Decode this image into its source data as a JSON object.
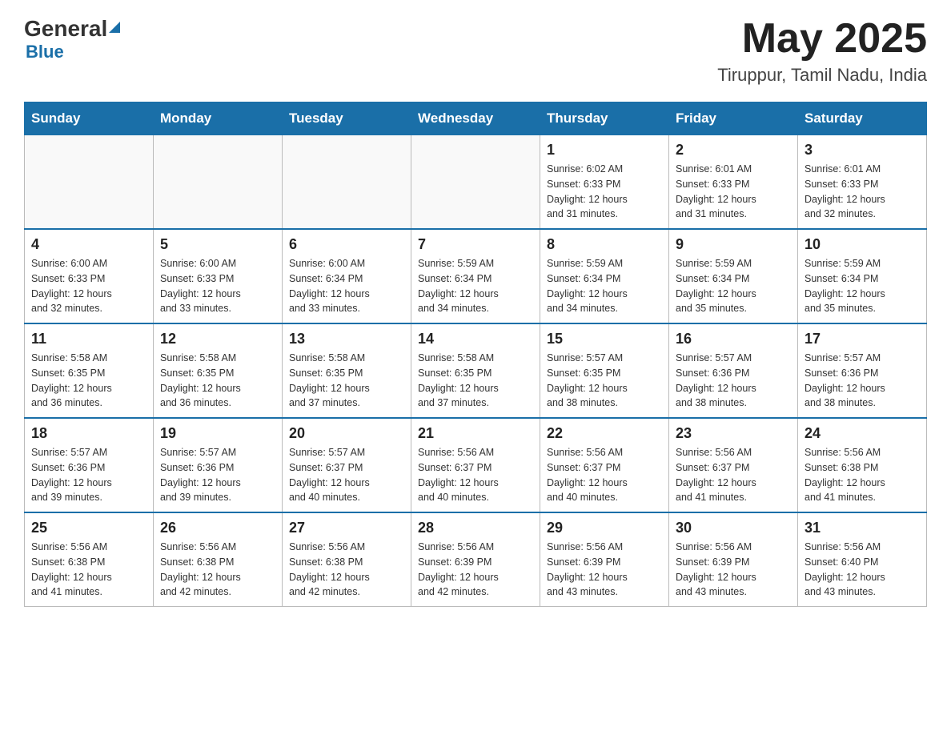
{
  "header": {
    "logo_general": "General",
    "logo_blue": "Blue",
    "month": "May 2025",
    "location": "Tiruppur, Tamil Nadu, India"
  },
  "days_of_week": [
    "Sunday",
    "Monday",
    "Tuesday",
    "Wednesday",
    "Thursday",
    "Friday",
    "Saturday"
  ],
  "weeks": [
    [
      {
        "day": "",
        "info": ""
      },
      {
        "day": "",
        "info": ""
      },
      {
        "day": "",
        "info": ""
      },
      {
        "day": "",
        "info": ""
      },
      {
        "day": "1",
        "info": "Sunrise: 6:02 AM\nSunset: 6:33 PM\nDaylight: 12 hours\nand 31 minutes."
      },
      {
        "day": "2",
        "info": "Sunrise: 6:01 AM\nSunset: 6:33 PM\nDaylight: 12 hours\nand 31 minutes."
      },
      {
        "day": "3",
        "info": "Sunrise: 6:01 AM\nSunset: 6:33 PM\nDaylight: 12 hours\nand 32 minutes."
      }
    ],
    [
      {
        "day": "4",
        "info": "Sunrise: 6:00 AM\nSunset: 6:33 PM\nDaylight: 12 hours\nand 32 minutes."
      },
      {
        "day": "5",
        "info": "Sunrise: 6:00 AM\nSunset: 6:33 PM\nDaylight: 12 hours\nand 33 minutes."
      },
      {
        "day": "6",
        "info": "Sunrise: 6:00 AM\nSunset: 6:34 PM\nDaylight: 12 hours\nand 33 minutes."
      },
      {
        "day": "7",
        "info": "Sunrise: 5:59 AM\nSunset: 6:34 PM\nDaylight: 12 hours\nand 34 minutes."
      },
      {
        "day": "8",
        "info": "Sunrise: 5:59 AM\nSunset: 6:34 PM\nDaylight: 12 hours\nand 34 minutes."
      },
      {
        "day": "9",
        "info": "Sunrise: 5:59 AM\nSunset: 6:34 PM\nDaylight: 12 hours\nand 35 minutes."
      },
      {
        "day": "10",
        "info": "Sunrise: 5:59 AM\nSunset: 6:34 PM\nDaylight: 12 hours\nand 35 minutes."
      }
    ],
    [
      {
        "day": "11",
        "info": "Sunrise: 5:58 AM\nSunset: 6:35 PM\nDaylight: 12 hours\nand 36 minutes."
      },
      {
        "day": "12",
        "info": "Sunrise: 5:58 AM\nSunset: 6:35 PM\nDaylight: 12 hours\nand 36 minutes."
      },
      {
        "day": "13",
        "info": "Sunrise: 5:58 AM\nSunset: 6:35 PM\nDaylight: 12 hours\nand 37 minutes."
      },
      {
        "day": "14",
        "info": "Sunrise: 5:58 AM\nSunset: 6:35 PM\nDaylight: 12 hours\nand 37 minutes."
      },
      {
        "day": "15",
        "info": "Sunrise: 5:57 AM\nSunset: 6:35 PM\nDaylight: 12 hours\nand 38 minutes."
      },
      {
        "day": "16",
        "info": "Sunrise: 5:57 AM\nSunset: 6:36 PM\nDaylight: 12 hours\nand 38 minutes."
      },
      {
        "day": "17",
        "info": "Sunrise: 5:57 AM\nSunset: 6:36 PM\nDaylight: 12 hours\nand 38 minutes."
      }
    ],
    [
      {
        "day": "18",
        "info": "Sunrise: 5:57 AM\nSunset: 6:36 PM\nDaylight: 12 hours\nand 39 minutes."
      },
      {
        "day": "19",
        "info": "Sunrise: 5:57 AM\nSunset: 6:36 PM\nDaylight: 12 hours\nand 39 minutes."
      },
      {
        "day": "20",
        "info": "Sunrise: 5:57 AM\nSunset: 6:37 PM\nDaylight: 12 hours\nand 40 minutes."
      },
      {
        "day": "21",
        "info": "Sunrise: 5:56 AM\nSunset: 6:37 PM\nDaylight: 12 hours\nand 40 minutes."
      },
      {
        "day": "22",
        "info": "Sunrise: 5:56 AM\nSunset: 6:37 PM\nDaylight: 12 hours\nand 40 minutes."
      },
      {
        "day": "23",
        "info": "Sunrise: 5:56 AM\nSunset: 6:37 PM\nDaylight: 12 hours\nand 41 minutes."
      },
      {
        "day": "24",
        "info": "Sunrise: 5:56 AM\nSunset: 6:38 PM\nDaylight: 12 hours\nand 41 minutes."
      }
    ],
    [
      {
        "day": "25",
        "info": "Sunrise: 5:56 AM\nSunset: 6:38 PM\nDaylight: 12 hours\nand 41 minutes."
      },
      {
        "day": "26",
        "info": "Sunrise: 5:56 AM\nSunset: 6:38 PM\nDaylight: 12 hours\nand 42 minutes."
      },
      {
        "day": "27",
        "info": "Sunrise: 5:56 AM\nSunset: 6:38 PM\nDaylight: 12 hours\nand 42 minutes."
      },
      {
        "day": "28",
        "info": "Sunrise: 5:56 AM\nSunset: 6:39 PM\nDaylight: 12 hours\nand 42 minutes."
      },
      {
        "day": "29",
        "info": "Sunrise: 5:56 AM\nSunset: 6:39 PM\nDaylight: 12 hours\nand 43 minutes."
      },
      {
        "day": "30",
        "info": "Sunrise: 5:56 AM\nSunset: 6:39 PM\nDaylight: 12 hours\nand 43 minutes."
      },
      {
        "day": "31",
        "info": "Sunrise: 5:56 AM\nSunset: 6:40 PM\nDaylight: 12 hours\nand 43 minutes."
      }
    ]
  ]
}
